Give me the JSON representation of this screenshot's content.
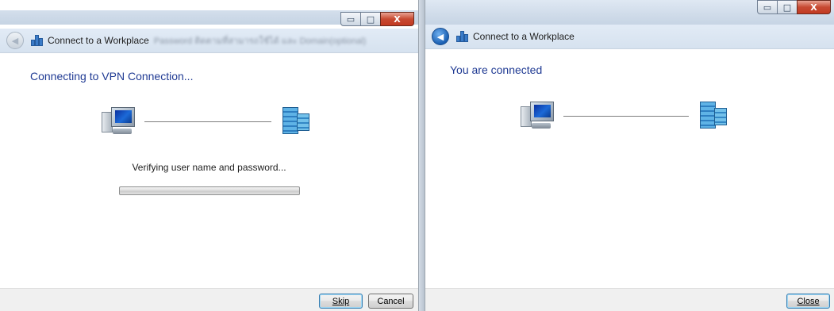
{
  "left_window": {
    "caption_buttons": {
      "minimize": "▭",
      "maximize": "□",
      "close": "X"
    },
    "nav": {
      "title": "Connect to a Workplace",
      "blurred_text": "Password ติดตามที่สามารถใช้ได้ และ Domain(optional)"
    },
    "heading": "Connecting to VPN Connection...",
    "status": "Verifying user name and password...",
    "progress": 0,
    "buttons": {
      "skip": "Skip",
      "cancel": "Cancel"
    }
  },
  "right_window": {
    "caption_buttons": {
      "minimize": "▭",
      "maximize": "□",
      "close": "X"
    },
    "nav": {
      "title": "Connect to a Workplace"
    },
    "heading": "You are connected",
    "buttons": {
      "close": "Close"
    }
  },
  "icons": {
    "back": "back-arrow-icon",
    "app": "workplace-icon",
    "computer": "computer-icon",
    "server": "server-icon"
  }
}
